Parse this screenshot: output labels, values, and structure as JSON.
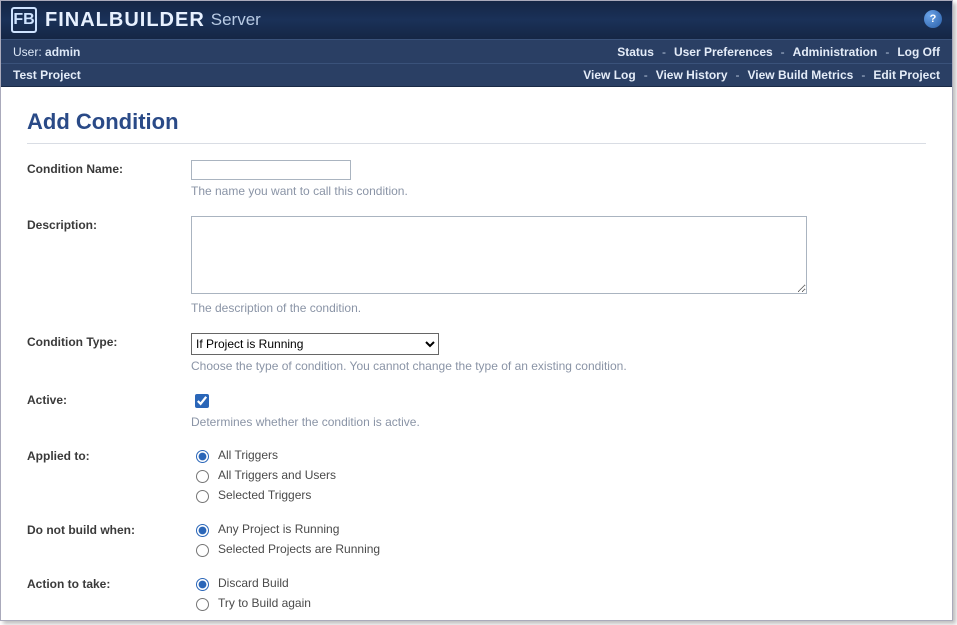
{
  "brand": {
    "main": "FINALBUILDER",
    "sub": "Server",
    "logo_glyph": "FB"
  },
  "nav1": {
    "user_label": "User:",
    "user_name": "admin",
    "links": [
      "Status",
      "User Preferences",
      "Administration",
      "Log Off"
    ]
  },
  "nav2": {
    "project": "Test Project",
    "links": [
      "View Log",
      "View History",
      "View Build Metrics",
      "Edit Project"
    ]
  },
  "page": {
    "title": "Add Condition"
  },
  "form": {
    "condition_name": {
      "label": "Condition Name:",
      "value": "",
      "help": "The name you want to call this condition."
    },
    "description": {
      "label": "Description:",
      "value": "",
      "help": "The description of the condition."
    },
    "condition_type": {
      "label": "Condition Type:",
      "selected": "If Project is Running",
      "help": "Choose the type of condition. You cannot change the type of an existing condition."
    },
    "active": {
      "label": "Active:",
      "checked": true,
      "help": "Determines whether the condition is active."
    },
    "applied_to": {
      "label": "Applied to:",
      "options": [
        "All Triggers",
        "All Triggers and Users",
        "Selected Triggers"
      ],
      "selected": 0
    },
    "do_not_build": {
      "label": "Do not build when:",
      "options": [
        "Any Project is Running",
        "Selected Projects are Running"
      ],
      "selected": 0
    },
    "action": {
      "label": "Action to take:",
      "options": [
        "Discard Build",
        "Try to Build again"
      ],
      "selected": 0
    }
  }
}
